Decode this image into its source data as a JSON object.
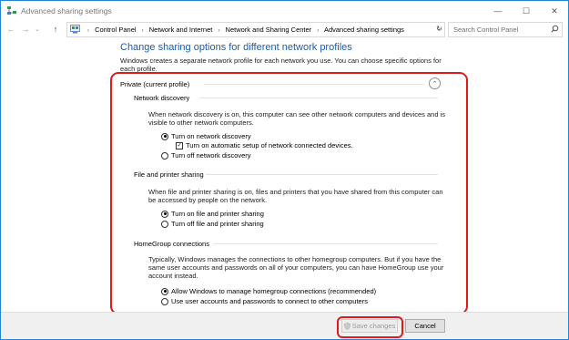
{
  "window": {
    "title": "Advanced sharing settings",
    "buttons": {
      "minimize": "—",
      "maximize": "☐",
      "close": "✕"
    }
  },
  "nav": {
    "back_glyph": "←",
    "forward_glyph": "→",
    "recent_glyph": "⌄",
    "up_glyph": "↑",
    "breadcrumbs": [
      "Control Panel",
      "Network and Internet",
      "Network and Sharing Center",
      "Advanced sharing settings"
    ],
    "separator": "›",
    "dropdown_glyph": "⌄",
    "refresh_glyph": "↻"
  },
  "search": {
    "placeholder": "Search Control Panel"
  },
  "page": {
    "heading": "Change sharing options for different network profiles",
    "intro": "Windows creates a separate network profile for each network you use. You can choose specific options for each profile."
  },
  "profile": {
    "title": "Private (current profile)",
    "collapse_glyph": "⌃",
    "sections": [
      {
        "title": "Network discovery",
        "description": "When network discovery is on, this computer can see other network computers and devices and is visible to other network computers.",
        "options": [
          {
            "label": "Turn on network discovery",
            "selected": true
          },
          {
            "label": "Turn on automatic setup of network connected devices.",
            "checked": true,
            "type": "checkbox"
          },
          {
            "label": "Turn off network discovery",
            "selected": false
          }
        ]
      },
      {
        "title": "File and printer sharing",
        "description": "When file and printer sharing is on, files and printers that you have shared from this computer can be accessed by people on the network.",
        "options": [
          {
            "label": "Turn on file and printer sharing",
            "selected": true
          },
          {
            "label": "Turn off file and printer sharing",
            "selected": false
          }
        ]
      },
      {
        "title": "HomeGroup connections",
        "description": "Typically, Windows manages the connections to other homegroup computers. But if you have the same user accounts and passwords on all of your computers, you can have HomeGroup use your account instead.",
        "options": [
          {
            "label": "Allow Windows to manage homegroup connections (recommended)",
            "selected": true
          },
          {
            "label": "Use user accounts and passwords to connect to other computers",
            "selected": false
          }
        ]
      }
    ]
  },
  "footer": {
    "save_label": "Save changes",
    "cancel_label": "Cancel"
  },
  "colors": {
    "heading": "#1e5aa8",
    "highlight": "#e01a1a",
    "window_border": "#1e88d6"
  }
}
